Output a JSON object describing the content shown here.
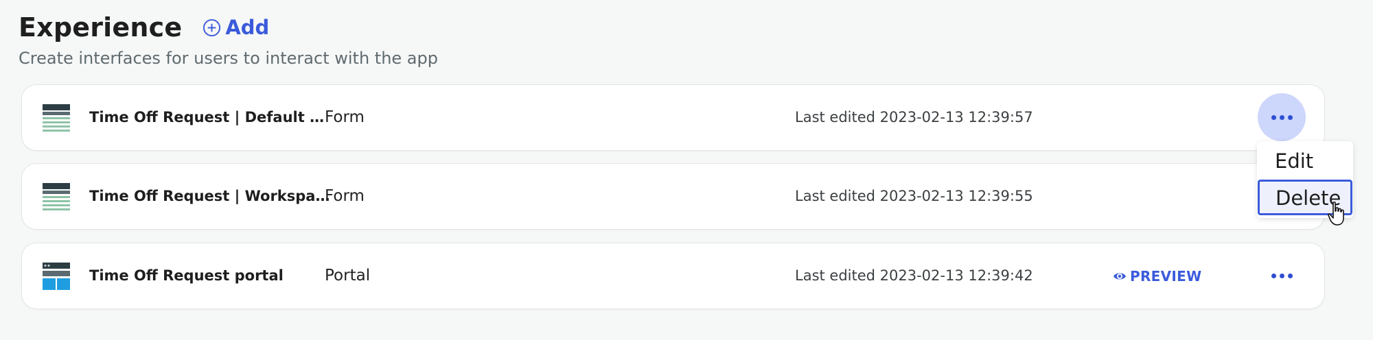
{
  "header": {
    "title": "Experience",
    "add_label": "Add",
    "subtitle": "Create interfaces for users to interact with the app"
  },
  "colors": {
    "accent": "#3b5bdb",
    "more_active_bg": "#cdd6fb",
    "page_bg": "#f6f7f7"
  },
  "rows": [
    {
      "icon": "form-table-icon",
      "name": "Time Off Request | Default vi...",
      "type": "Form",
      "edited": "Last edited 2023-02-13 12:39:57",
      "preview_label": "",
      "menu_open": true
    },
    {
      "icon": "form-table-icon",
      "name": "Time Off Request | Workspace",
      "type": "Form",
      "edited": "Last edited 2023-02-13 12:39:55",
      "preview_label": "",
      "menu_open": false
    },
    {
      "icon": "portal-layout-icon",
      "name": "Time Off Request portal",
      "type": "Portal",
      "edited": "Last edited 2023-02-13 12:39:42",
      "preview_label": "PREVIEW",
      "menu_open": false
    }
  ],
  "menu": {
    "items": [
      {
        "label": "Edit",
        "hovered": false
      },
      {
        "label": "Delete",
        "hovered": true
      }
    ]
  }
}
